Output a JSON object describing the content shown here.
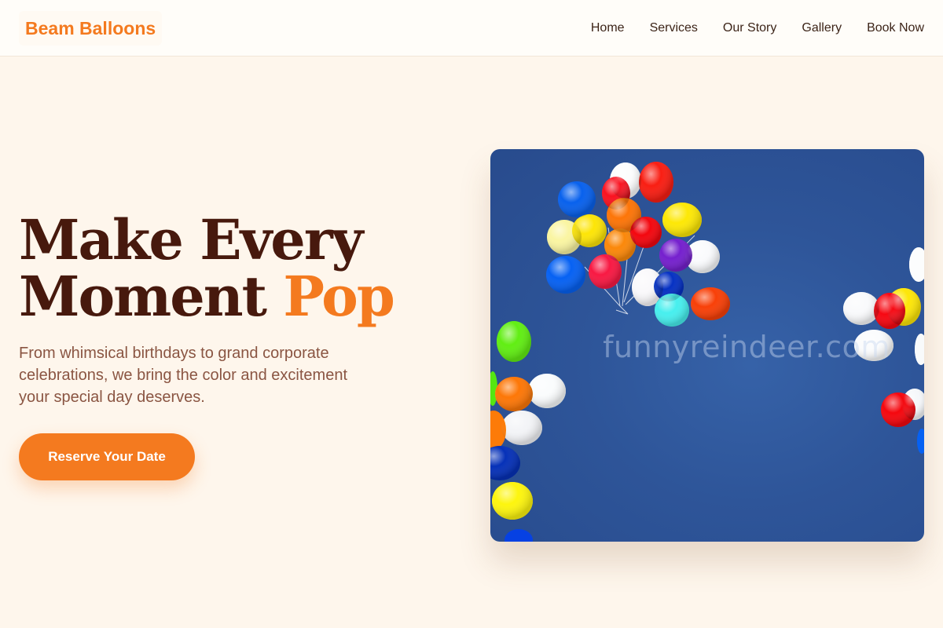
{
  "brand": {
    "name": "Beam Balloons"
  },
  "nav": {
    "items": [
      {
        "label": "Home"
      },
      {
        "label": "Services"
      },
      {
        "label": "Our Story"
      },
      {
        "label": "Gallery"
      },
      {
        "label": "Book Now"
      }
    ]
  },
  "hero": {
    "title_line1": "Make Every",
    "title_line2_main": "Moment",
    "title_line2_accent": "Pop",
    "subtitle": "From whimsical birthdays to grand corporate celebrations, we bring the color and excitement your special day deserves.",
    "cta_label": "Reserve Your Date",
    "image_watermark": "funnyreindeer.com"
  },
  "colors": {
    "accent": "#f47a1f",
    "heading": "#47190d",
    "body_text": "#8a5542",
    "background": "#fef6ec",
    "sky": "#2e5599"
  }
}
